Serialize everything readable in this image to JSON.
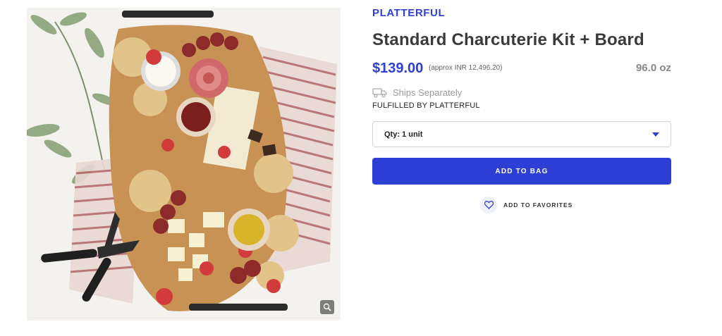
{
  "product": {
    "image_alt": "Charcuterie board with cheeses, meats, crackers and strawberries",
    "brand": "PLATTERFUL",
    "title": "Standard Charcuterie Kit + Board",
    "price": "$139.00",
    "approx_price": "(approx INR 12,496.20)",
    "weight": "96.0 oz",
    "shipping": "Ships Separately",
    "fulfilled_by": "FULFILLED BY PLATTERFUL",
    "quantity_selected": "Qty: 1 unit",
    "add_to_bag_label": "ADD TO BAG",
    "add_to_favorites_label": "ADD TO FAVORITES"
  },
  "icons": {
    "zoom": "magnifier-icon",
    "shipping": "truck-icon",
    "quantity": "caret-down-icon",
    "favorite": "heart-icon"
  },
  "colors": {
    "accent": "#2e3fd6",
    "text": "#3a3a3a",
    "muted": "#999999"
  }
}
